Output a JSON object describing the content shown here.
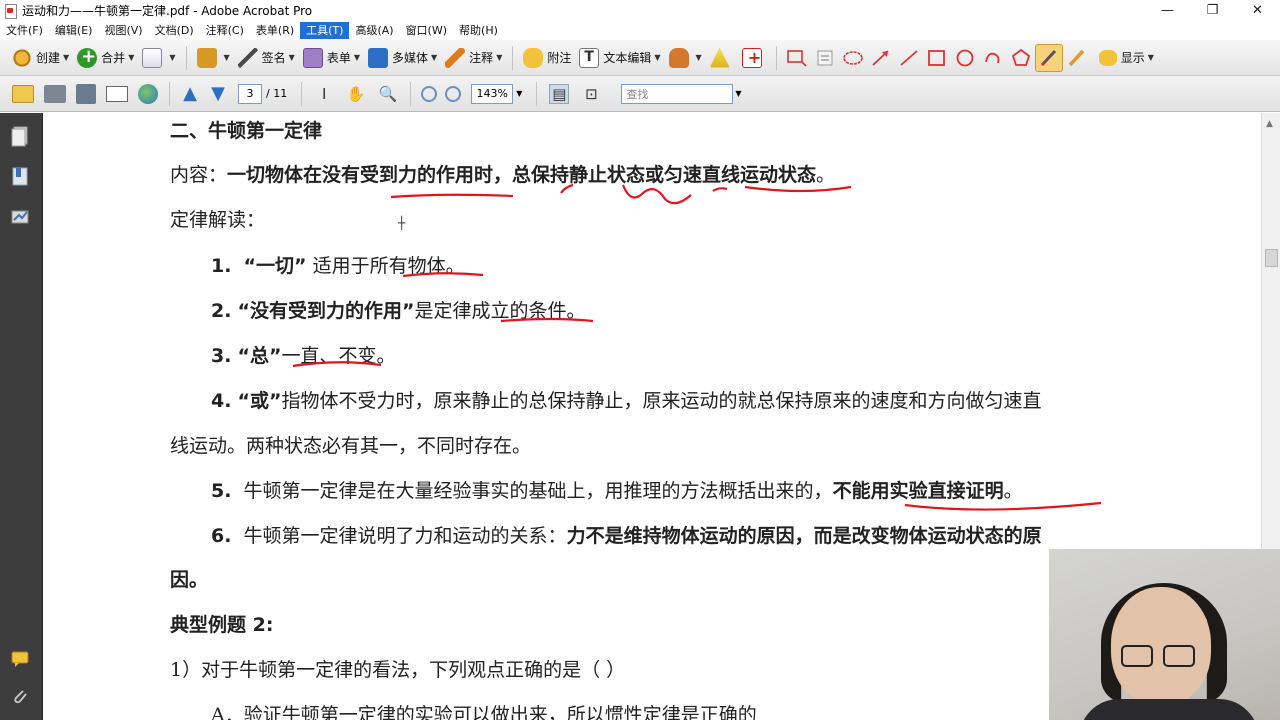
{
  "window": {
    "title": "运动和力——牛顿第一定律.pdf - Adobe Acrobat Pro"
  },
  "window_controls": {
    "minimize": "—",
    "restore": "❐",
    "close": "✕"
  },
  "menu": [
    "文件(F)",
    "编辑(E)",
    "视图(V)",
    "文档(D)",
    "注释(C)",
    "表单(R)",
    "工具(T)",
    "高级(A)",
    "窗口(W)",
    "帮助(H)"
  ],
  "menu_active": "工具(T)",
  "toolbar": {
    "create": "创建",
    "combine": "合并",
    "sign": "签名",
    "forms": "表单",
    "multimedia": "多媒体",
    "comment": "注释",
    "attach": "附注",
    "text_edit": "文本编辑",
    "show": "显示"
  },
  "nav": {
    "page_current": "3",
    "page_total": "/ 11",
    "zoom": "143%",
    "find_placeholder": "查找"
  },
  "doc": {
    "heading": "二、牛顿第一定律",
    "content_label": "内容：",
    "content_text": "一切物体在没有受到力的作用时，总保持静止状态或匀速直线运动状态",
    "content_end": "。",
    "interp": "定律解读：",
    "items": {
      "i1_num": "1.",
      "i1_q": "“一切”",
      "i1_text": "适用于所有物体。",
      "i2_num": "2.",
      "i2_q": "“没有受到力的作用”",
      "i2_text": "是定律成立的条件。",
      "i3_num": "3.",
      "i3_q": "“总”",
      "i3_text": "一直、不变。",
      "i4_num": "4.",
      "i4_q": "“或”",
      "i4_text": "指物体不受力时，原来静止的总保持静止，原来运动的就总保持原来的速度和方向做匀速直",
      "i4_cont": "线运动。两种状态必有其一，不同时存在。",
      "i5_num": "5.",
      "i5_text": "牛顿第一定律是在大量经验事实的基础上，用推理的方法概括出来的，",
      "i5_bold": "不能用实验直接证明",
      "i5_end": "。",
      "i6_num": "6.",
      "i6_text": "牛顿第一定律说明了力和运动的关系：",
      "i6_bold": "力不是维持物体运动的原因，而是改变物体运动状态的原",
      "i6_cont": "因。"
    },
    "example_title": "典型例题 2:",
    "q1": "1）对于牛顿第一定律的看法，下列观点正确的是（    ）",
    "optA": "A．验证牛顿第一定律的实验可以做出来，所以惯性定律是正确的"
  },
  "colors": {
    "menu_active": "#1e6fd6",
    "annotation_red": "#e0151d",
    "left_pane": "#3d3d3d"
  },
  "icons": {
    "left_pane": [
      "pages-icon",
      "bookmarks-icon",
      "signatures-icon",
      "comments-icon",
      "attachments-icon"
    ]
  }
}
